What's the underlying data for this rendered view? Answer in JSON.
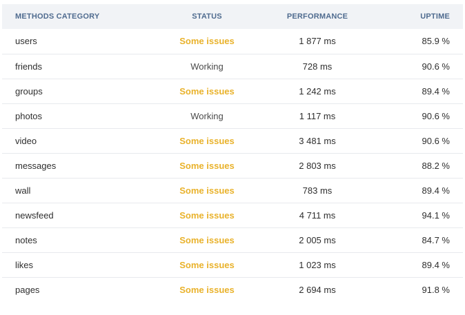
{
  "colors": {
    "header_bg": "#f1f3f6",
    "header_text": "#4f6b8f",
    "issue": "#e9b22b",
    "working": "#4a4a4a",
    "divider": "#e7e9ed"
  },
  "table": {
    "headers": {
      "method": "METHODS CATEGORY",
      "status": "STATUS",
      "performance": "PERFORMANCE",
      "uptime": "UPTIME"
    },
    "rows": [
      {
        "method": "users",
        "status": "Some issues",
        "status_kind": "issue",
        "performance": "1 877 ms",
        "uptime": "85.9 %"
      },
      {
        "method": "friends",
        "status": "Working",
        "status_kind": "ok",
        "performance": "728 ms",
        "uptime": "90.6 %"
      },
      {
        "method": "groups",
        "status": "Some issues",
        "status_kind": "issue",
        "performance": "1 242 ms",
        "uptime": "89.4 %"
      },
      {
        "method": "photos",
        "status": "Working",
        "status_kind": "ok",
        "performance": "1 117 ms",
        "uptime": "90.6 %"
      },
      {
        "method": "video",
        "status": "Some issues",
        "status_kind": "issue",
        "performance": "3 481 ms",
        "uptime": "90.6 %"
      },
      {
        "method": "messages",
        "status": "Some issues",
        "status_kind": "issue",
        "performance": "2 803 ms",
        "uptime": "88.2 %"
      },
      {
        "method": "wall",
        "status": "Some issues",
        "status_kind": "issue",
        "performance": "783 ms",
        "uptime": "89.4 %"
      },
      {
        "method": "newsfeed",
        "status": "Some issues",
        "status_kind": "issue",
        "performance": "4 711 ms",
        "uptime": "94.1 %"
      },
      {
        "method": "notes",
        "status": "Some issues",
        "status_kind": "issue",
        "performance": "2 005 ms",
        "uptime": "84.7 %"
      },
      {
        "method": "likes",
        "status": "Some issues",
        "status_kind": "issue",
        "performance": "1 023 ms",
        "uptime": "89.4 %"
      },
      {
        "method": "pages",
        "status": "Some issues",
        "status_kind": "issue",
        "performance": "2 694 ms",
        "uptime": "91.8 %"
      }
    ]
  }
}
